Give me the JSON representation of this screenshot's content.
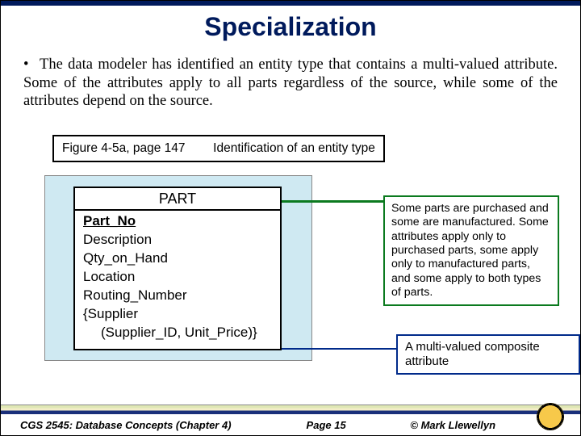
{
  "title": "Specialization",
  "body": "The data modeler has identified an entity type that contains a multi-valued attribute.  Some of the attributes apply to all parts regardless of the source, while some of the attributes depend on the source.",
  "figure_label": {
    "ref": "Figure 4-5a, page 147",
    "caption": "Identification of an entity type"
  },
  "entity": {
    "name": "PART",
    "pk": "Part_No",
    "attrs": [
      "Description",
      "Qty_on_Hand",
      "Location",
      "Routing_Number"
    ],
    "multivalued": {
      "outer": "{Supplier",
      "inner": "(Supplier_ID, Unit_Price)}"
    }
  },
  "callout1": "Some parts are purchased and some are manufactured. Some attributes apply only to purchased parts, some apply only to manufactured parts, and some apply to both types of parts.",
  "callout2": "A multi-valued composite attribute",
  "footer": {
    "course": "CGS 2545: Database Concepts (Chapter 4)",
    "page": "Page 15",
    "author": "© Mark Llewellyn"
  }
}
